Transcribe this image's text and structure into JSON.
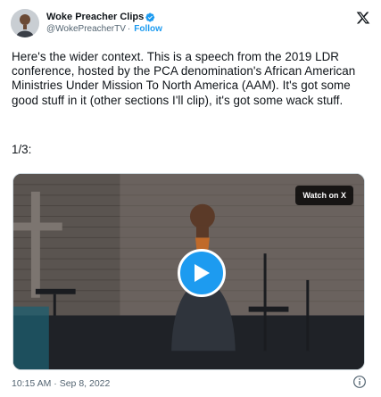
{
  "author": {
    "display_name": "Woke Preacher Clips",
    "handle": "@WokePreacherTV",
    "separator": "·",
    "follow_label": "Follow"
  },
  "tweet": {
    "text": "Here's the wider context. This is a speech from the 2019 LDR conference, hosted by the PCA denomination's African American Ministries Under Mission To North America (AAM). It's got some good stuff in it (other sections I'll clip), it's got some wack stuff.",
    "counter": "1/3:"
  },
  "video": {
    "watch_label": "Watch on X"
  },
  "footer": {
    "time": "10:15 AM",
    "separator": "·",
    "date": "Sep 8, 2022"
  },
  "colors": {
    "accent": "#1d9bf0",
    "text": "#0f1419",
    "secondary": "#536471"
  },
  "icons": {
    "verified": "verified-badge-icon",
    "logo": "x-logo-icon",
    "play": "play-icon",
    "info": "info-icon"
  }
}
